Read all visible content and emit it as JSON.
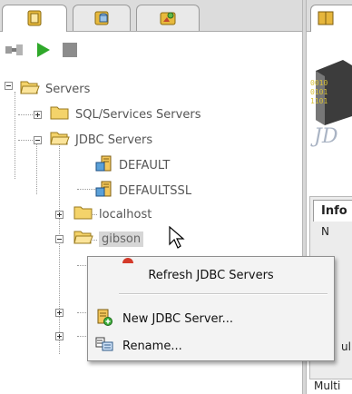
{
  "left_panel": {
    "tabs": [
      {
        "icon": "servers-tab-icon"
      },
      {
        "icon": "database-tab-icon"
      },
      {
        "icon": "resources-tab-icon"
      }
    ],
    "toolbar": [
      {
        "icon": "connect-icon"
      },
      {
        "icon": "play-icon"
      },
      {
        "icon": "stop-icon"
      }
    ],
    "tree": {
      "root": "Servers",
      "sql_services": "SQL/Services Servers",
      "jdbc_servers": "JDBC Servers",
      "default": "DEFAULT",
      "defaultssl": "DEFAULTSSL",
      "localhost": "localhost",
      "gibson": "gibson"
    }
  },
  "right_panel": {
    "logo_text": "JD",
    "info_tab_label": "Info",
    "labels": {
      "name_partial": "N",
      "lower_partial": "ul",
      "multi_partial": "Multi"
    }
  },
  "context_menu": {
    "refresh": "Refresh JDBC Servers",
    "new_server": "New JDBC Server...",
    "rename": "Rename..."
  },
  "colors": {
    "folder": "#f4d36a",
    "play": "#2fa82a",
    "stop": "#8c8c8c",
    "selection": "#d6d6d6"
  }
}
